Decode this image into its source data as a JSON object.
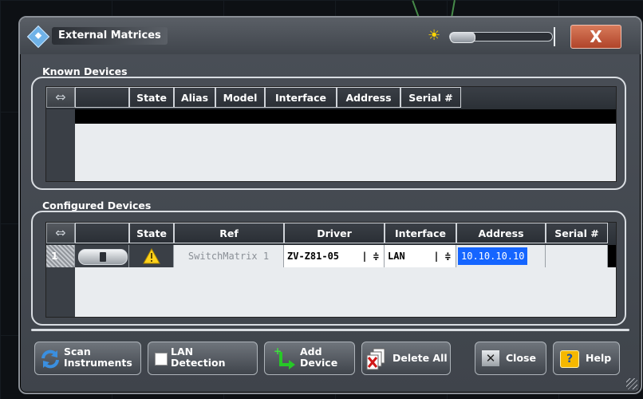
{
  "dialog": {
    "title": "External Matrices",
    "close_label": "X"
  },
  "known": {
    "section_label": "Known Devices",
    "columns": [
      "State",
      "Alias",
      "Model",
      "Interface",
      "Address",
      "Serial #"
    ]
  },
  "configured": {
    "section_label": "Configured Devices",
    "columns": [
      "State",
      "Ref",
      "Driver",
      "Interface",
      "Address",
      "Serial #"
    ],
    "rows": [
      {
        "row_number": "1",
        "state_icon": "warning-icon",
        "ref": "SwitchMatrix 1",
        "driver": "ZV-Z81-05",
        "interface": "LAN",
        "address": "10.10.10.10",
        "serial": ""
      }
    ]
  },
  "buttons": {
    "scan_line1": "Scan",
    "scan_line2": "Instruments",
    "lan_line1": "LAN",
    "lan_line2": "Detection",
    "add_line1": "Add",
    "add_line2": "Device",
    "delete_all": "Delete All",
    "close": "Close",
    "help": "Help"
  },
  "colors": {
    "address_highlight": "#1565ff",
    "warning": "#ffd21a",
    "accent_blue": "#3a8fe0"
  }
}
